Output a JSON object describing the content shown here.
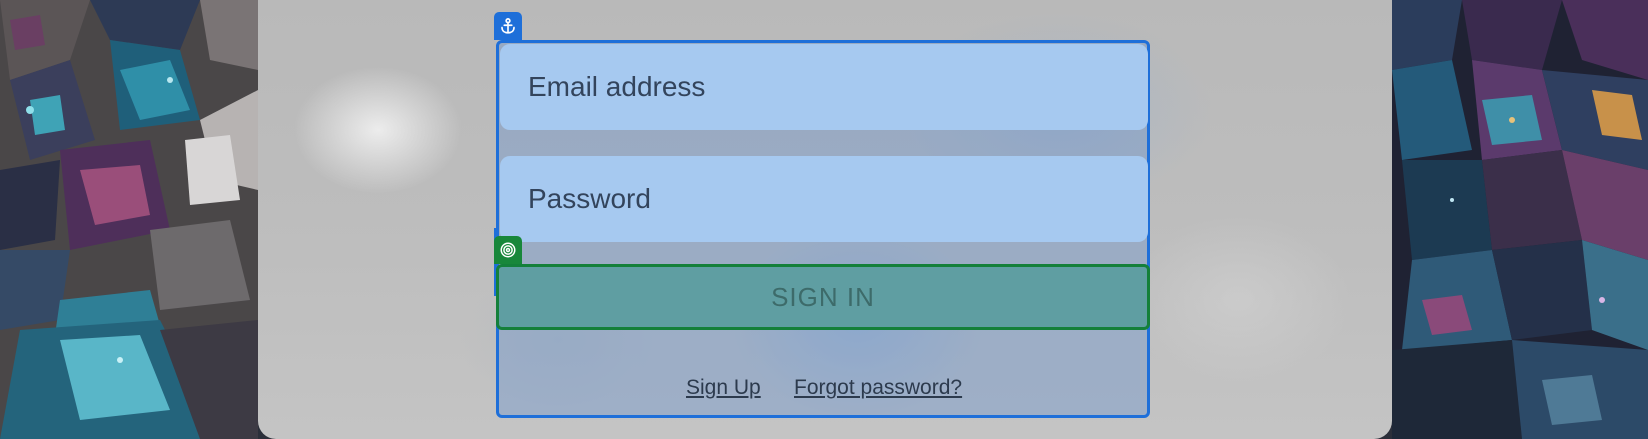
{
  "form": {
    "email_placeholder": "Email address",
    "password_placeholder": "Password",
    "sign_in_label": "SIGN IN",
    "sign_up_label": "Sign Up",
    "forgot_password_label": "Forgot password?"
  },
  "colors": {
    "card_border": "#1e6fd9",
    "field_background": "#a6c9f0",
    "sign_in_border": "#14803a",
    "sign_in_background": "#5f9ea2"
  },
  "icons": {
    "card_tag": "anchor-icon",
    "button_tag": "target-icon"
  }
}
